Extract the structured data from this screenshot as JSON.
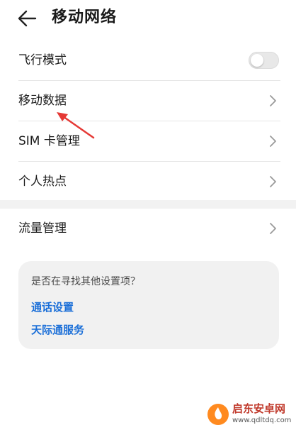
{
  "header": {
    "title": "移动网络",
    "back_icon": "arrow-left-icon"
  },
  "settings": [
    {
      "label": "飞行模式",
      "control": "toggle",
      "toggle_on": false
    },
    {
      "label": "移动数据",
      "control": "chevron"
    },
    {
      "label": "SIM 卡管理",
      "control": "chevron"
    },
    {
      "label": "个人热点",
      "control": "chevron"
    }
  ],
  "settings2": [
    {
      "label": "流量管理",
      "control": "chevron"
    }
  ],
  "suggestion_card": {
    "title": "是否在寻找其他设置项？",
    "links": [
      "通话设置",
      "天际通服务"
    ]
  },
  "annotation": {
    "color": "#e53935"
  },
  "watermark": {
    "name": "启东安卓网",
    "url": "www.qdltdq.com"
  },
  "colors": {
    "accent": "#1b6fd8",
    "divider": "#e6e6e6",
    "card": "#f1f1f1"
  }
}
